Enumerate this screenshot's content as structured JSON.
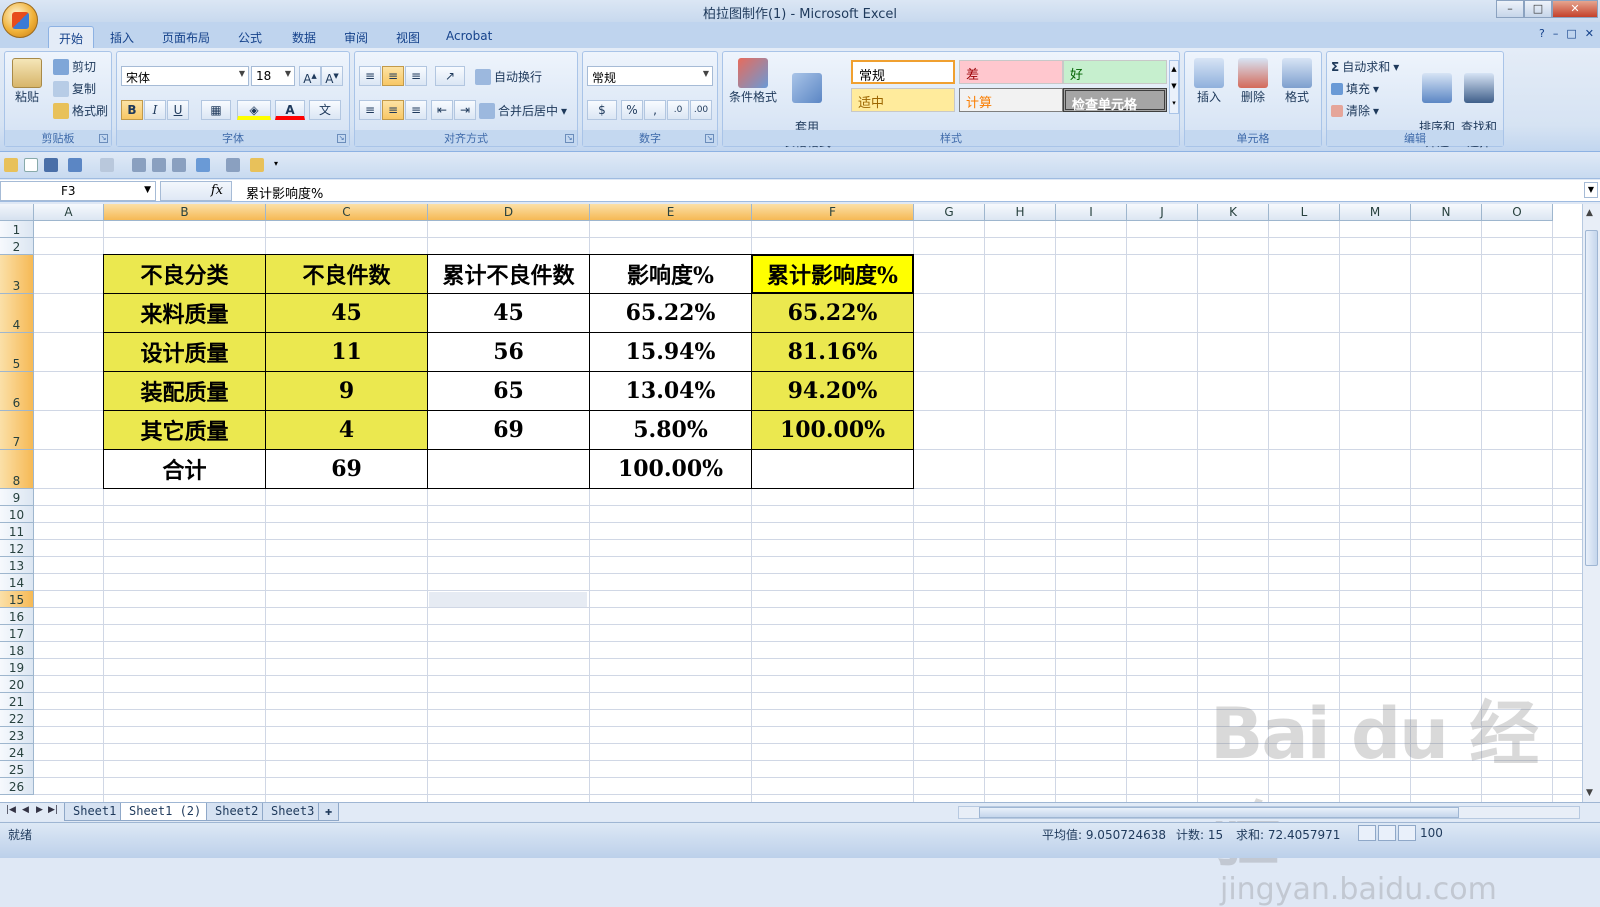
{
  "window": {
    "title": "柏拉图制作(1) - Microsoft Excel"
  },
  "tabs": [
    {
      "label": "开始",
      "active": true
    },
    {
      "label": "插入"
    },
    {
      "label": "页面布局"
    },
    {
      "label": "公式"
    },
    {
      "label": "数据"
    },
    {
      "label": "审阅"
    },
    {
      "label": "视图"
    },
    {
      "label": "Acrobat"
    }
  ],
  "ribbon": {
    "clipboard": {
      "paste": "粘贴",
      "cut": "剪切",
      "copy": "复制",
      "painter": "格式刷",
      "label": "剪贴板"
    },
    "font": {
      "name": "宋体",
      "size": "18",
      "bold": "B",
      "italic": "I",
      "underline": "U",
      "label": "字体"
    },
    "alignment": {
      "wrap": "自动换行",
      "merge": "合并后居中",
      "label": "对齐方式"
    },
    "number": {
      "format": "常规",
      "percent": "%",
      "comma": ",",
      "label": "数字"
    },
    "styles": {
      "conditional": "条件格式",
      "table_format": "套用\n表格格式",
      "cells": [
        {
          "text": "常规",
          "bg": "#ffffff",
          "color": "#000000"
        },
        {
          "text": "差",
          "bg": "#ffc7ce",
          "color": "#9c0006"
        },
        {
          "text": "好",
          "bg": "#c6efce",
          "color": "#006100"
        },
        {
          "text": "适中",
          "bg": "#ffeb9c",
          "color": "#9c6500"
        },
        {
          "text": "计算",
          "bg": "#f2f2f2",
          "color": "#fa7d00"
        },
        {
          "text": "检查单元格",
          "bg": "#a5a5a5",
          "color": "#ffffff"
        }
      ],
      "label": "样式"
    },
    "cells": {
      "insert": "插入",
      "delete": "删除",
      "format": "格式",
      "label": "单元格"
    },
    "editing": {
      "autosum": "自动求和",
      "fill": "填充",
      "clear": "清除",
      "sort": "排序和\n筛选",
      "find": "查找和\n选择",
      "label": "编辑"
    }
  },
  "formula_bar": {
    "name_box": "F3",
    "fx": "fx",
    "content": "累计影响度%"
  },
  "columns": [
    "A",
    "B",
    "C",
    "D",
    "E",
    "F",
    "G",
    "H",
    "I",
    "J",
    "K",
    "L",
    "M",
    "N",
    "O"
  ],
  "rows": [
    "1",
    "2",
    "3",
    "4",
    "5",
    "6",
    "7",
    "8",
    "9",
    "10",
    "11",
    "12",
    "13",
    "14",
    "15",
    "16",
    "17",
    "18",
    "19",
    "20",
    "21",
    "22",
    "23",
    "24",
    "25",
    "26"
  ],
  "table": {
    "headers": [
      "不良分类",
      "不良件数",
      "累计不良件数",
      "影响度%",
      "累计影响度%"
    ],
    "rows": [
      [
        "来料质量",
        "45",
        "45",
        "65.22%",
        "65.22%"
      ],
      [
        "设计质量",
        "11",
        "56",
        "15.94%",
        "81.16%"
      ],
      [
        "装配质量",
        "9",
        "65",
        "13.04%",
        "94.20%"
      ],
      [
        "其它质量",
        "4",
        "69",
        "5.80%",
        "100.00%"
      ],
      [
        "合计",
        "69",
        "",
        "100.00%",
        ""
      ]
    ]
  },
  "sheets": [
    {
      "label": "Sheet1"
    },
    {
      "label": "Sheet1 (2)",
      "active": true
    },
    {
      "label": "Sheet2"
    },
    {
      "label": "Sheet3"
    }
  ],
  "status": {
    "ready": "就绪",
    "average": "平均值: 9.050724638",
    "count": "计数: 15",
    "sum": "求和: 72.4057971",
    "zoom": "100"
  },
  "watermark": {
    "main": "Bai du 经验",
    "sub": "jingyan.baidu.com"
  }
}
